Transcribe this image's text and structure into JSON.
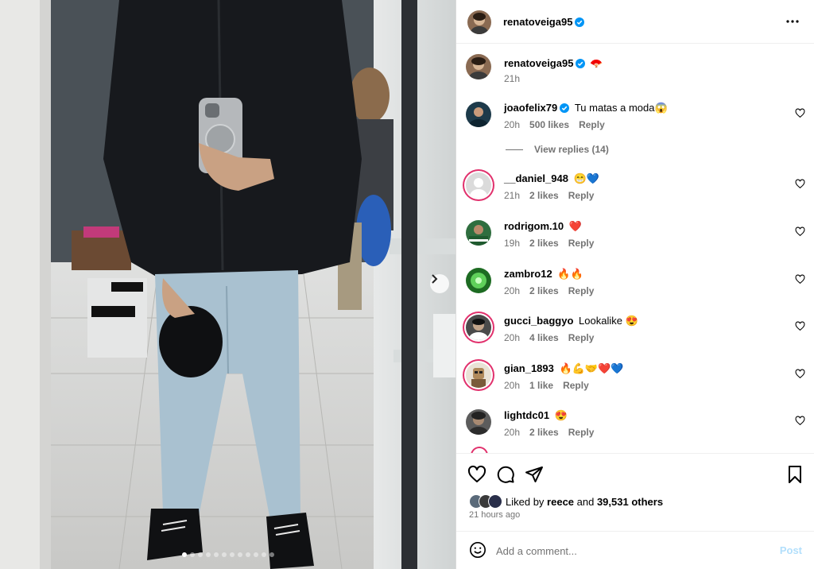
{
  "post": {
    "author": "renatoveiga95",
    "photo_count": 12,
    "active_photo": 1
  },
  "caption": {
    "username": "renatoveiga95",
    "emoji": "🪭",
    "time": "21h"
  },
  "comments": [
    {
      "username": "joaofelix79",
      "verified": true,
      "text": "Tu matas a moda😱",
      "time": "20h",
      "likes": "500 likes",
      "reply": "Reply",
      "avatar_color": "#1d3a4a"
    },
    {
      "username": "__daniel_948",
      "verified": false,
      "text": "😁💙",
      "time": "21h",
      "likes": "2 likes",
      "reply": "Reply",
      "avatar_color": "#c7c7c7",
      "story_ring": true
    },
    {
      "username": "rodrigom.10",
      "verified": false,
      "text": "❤️",
      "time": "19h",
      "likes": "2 likes",
      "reply": "Reply",
      "avatar_color": "#2f6e3f"
    },
    {
      "username": "zambro12",
      "verified": false,
      "text": "🔥🔥",
      "time": "20h",
      "likes": "2 likes",
      "reply": "Reply",
      "avatar_color": "#3aa43a"
    },
    {
      "username": "gucci_baggyo",
      "verified": false,
      "text": "Lookalike 😍",
      "time": "20h",
      "likes": "4 likes",
      "reply": "Reply",
      "avatar_color": "#5a5a5a",
      "story_ring": true
    },
    {
      "username": "gian_1893",
      "verified": false,
      "text": "🔥💪🤝❤️💙",
      "time": "20h",
      "likes": "1 like",
      "reply": "Reply",
      "avatar_color": "#c9a27a",
      "story_ring": true
    },
    {
      "username": "lightdc01",
      "verified": false,
      "text": "😍",
      "time": "20h",
      "likes": "2 likes",
      "reply": "Reply",
      "avatar_color": "#6b6b6b"
    }
  ],
  "view_replies": "View replies (14)",
  "likes": {
    "prefix": "Liked by ",
    "user": "reece",
    "middle": " and ",
    "count": "39,531 others"
  },
  "posted_ago": "21 hours ago",
  "comment_box": {
    "placeholder": "Add a comment...",
    "post_label": "Post"
  },
  "colors": {
    "verified_blue": "#0095f6",
    "story_ring": "#e1306c",
    "muted_text": "#737373",
    "post_disabled": "#b2dffc"
  }
}
